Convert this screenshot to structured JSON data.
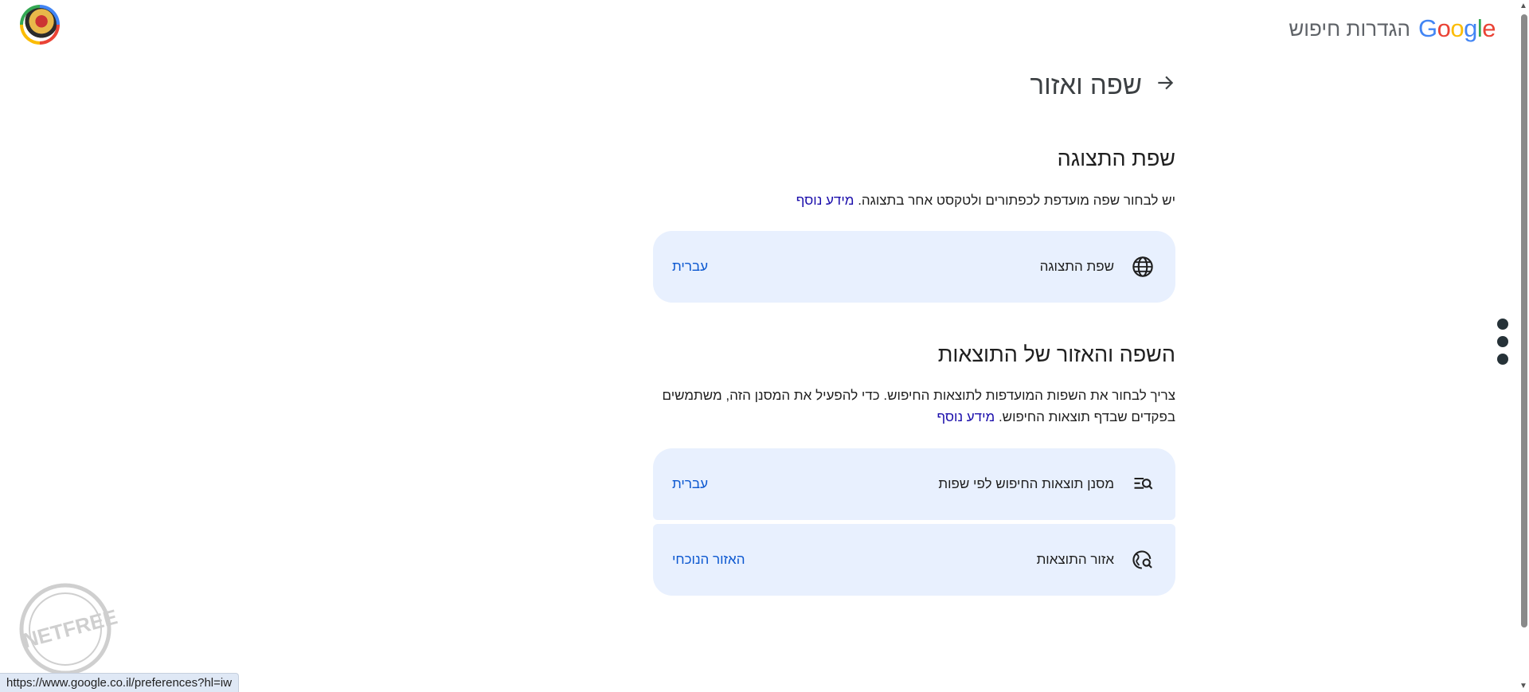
{
  "header": {
    "logo_letters": [
      {
        "ch": "G",
        "color": "#4285f4"
      },
      {
        "ch": "o",
        "color": "#ea4335"
      },
      {
        "ch": "o",
        "color": "#fbbc05"
      },
      {
        "ch": "g",
        "color": "#4285f4"
      },
      {
        "ch": "l",
        "color": "#34a853"
      },
      {
        "ch": "e",
        "color": "#ea4335"
      }
    ],
    "settings_title": "הגדרות חיפוש"
  },
  "page": {
    "title": "שפה ואזור",
    "back_icon": "arrow-right-icon"
  },
  "display_language": {
    "heading": "שפת התצוגה",
    "description": "יש לבחור שפה מועדפת לכפתורים ולטקסט אחר בתצוגה.",
    "learn_more": "מידע נוסף",
    "card": {
      "icon": "globe-icon",
      "label": "שפת התצוגה",
      "value": "עברית"
    }
  },
  "results_language": {
    "heading": "השפה והאזור של התוצאות",
    "description": "צריך לבחור את השפות המועדפות לתוצאות החיפוש. כדי להפעיל את המסנן הזה, משתמשים בפקדים שבדף תוצאות החיפוש.",
    "learn_more": "מידע נוסף",
    "cards": [
      {
        "icon": "filter-search-icon",
        "label": "מסנן תוצאות החיפוש לפי שפות",
        "value": "עברית"
      },
      {
        "icon": "globe-search-icon",
        "label": "אזור התוצאות",
        "value": "האזור הנוכחי"
      }
    ]
  },
  "status_bar": {
    "url": "https://www.google.co.il/preferences?hl=iw"
  },
  "watermark": {
    "text": "NETFREE"
  },
  "colors": {
    "card_bg": "#e8f0fe",
    "link": "#1a0dab",
    "value": "#0b57d0"
  }
}
